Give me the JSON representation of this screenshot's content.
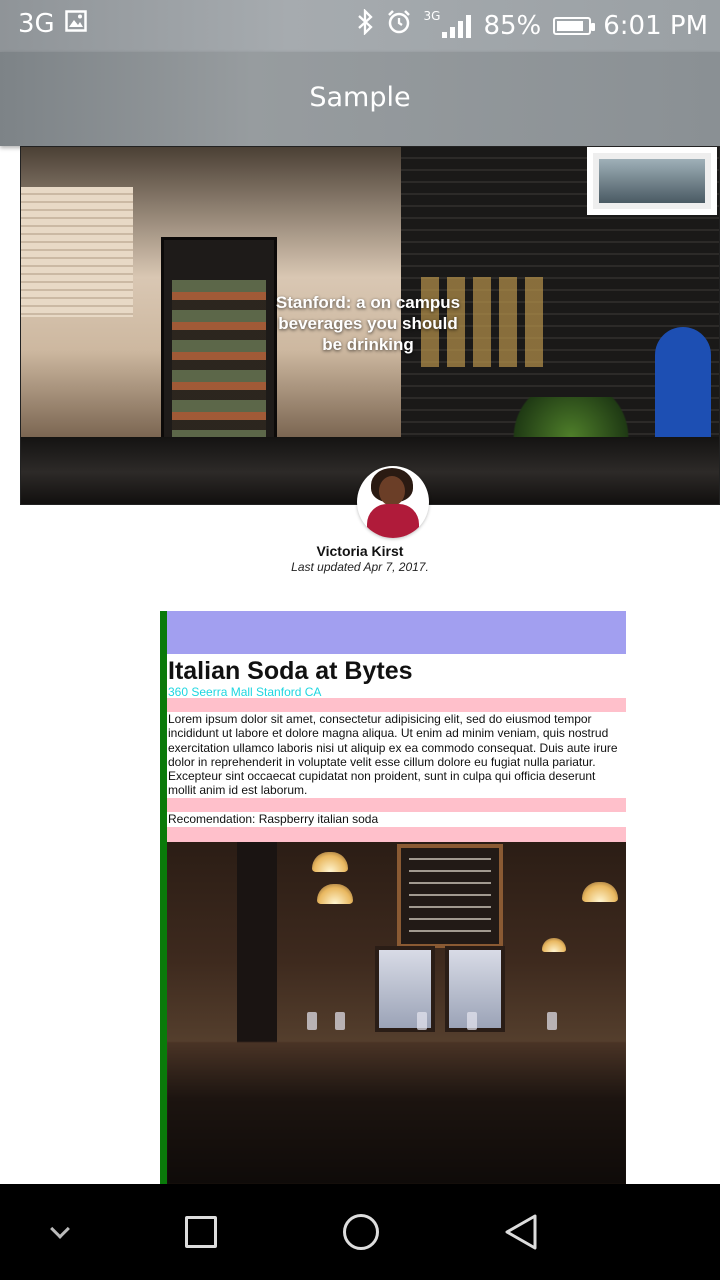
{
  "status_bar": {
    "network_left": "3G",
    "network_small": "3G",
    "battery_percent": "85%",
    "battery_level": 0.85,
    "time": "6:01 PM",
    "icons": [
      "image-icon",
      "bluetooth-icon",
      "alarm-icon",
      "signal-icon",
      "battery-icon"
    ]
  },
  "app_bar": {
    "title": "Sample"
  },
  "hero": {
    "title": "Stanford: a on campus beverages you should be drinking"
  },
  "author": {
    "name": "Victoria Kirst",
    "updated": "Last updated Apr 7, 2017."
  },
  "article": {
    "title": "Italian Soda at Bytes",
    "address": "360 Seerra Mall Stanford CA",
    "body": "Lorem ipsum dolor sit amet, consectetur adipisicing elit, sed do eiusmod tempor incididunt ut labore et dolore magna aliqua. Ut enim ad minim veniam, quis nostrud exercitation ullamco laboris nisi ut aliquip ex ea commodo consequat. Duis aute irure dolor in reprehenderit in voluptate velit esse cillum dolore eu fugiat nulla pariatur. Excepteur sint occaecat cupidatat non proident, sunt in culpa qui officia deserunt mollit anim id est laborum.",
    "recommendation": "Recomendation: Raspberry italian soda"
  },
  "colors": {
    "header_band": "#a29ff0",
    "accent_bar": "#0a7a0a",
    "pink_band": "#ffc0cb",
    "address": "#1fd6e0"
  },
  "nav_bar": {
    "icons": [
      "chevron-down-icon",
      "recents-square-icon",
      "home-circle-icon",
      "back-triangle-icon"
    ]
  }
}
